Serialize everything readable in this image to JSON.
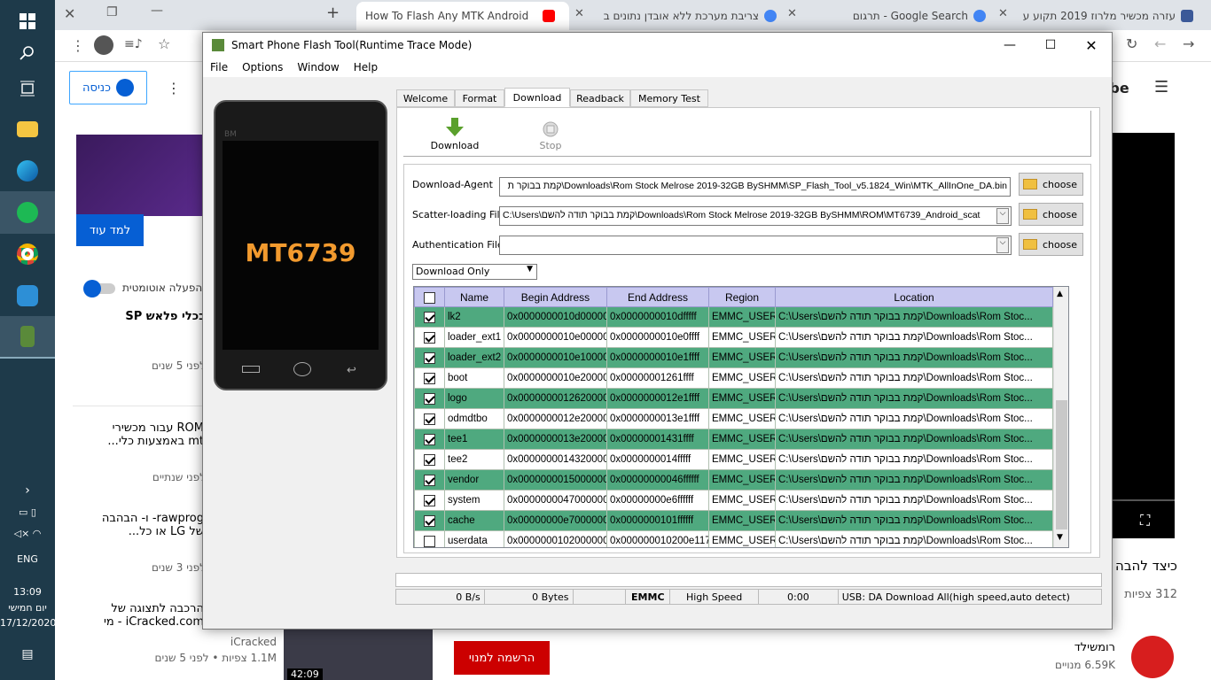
{
  "taskbar": {
    "lang": "ENG",
    "time": "13:09",
    "day": "יום חמישי",
    "date": "17/12/2020"
  },
  "browser": {
    "tabs": [
      {
        "title": "How To Flash Any MTK Android",
        "fav": "#ff0000"
      },
      {
        "title": "צריבת מערכת ללא אובדן נתונים ב",
        "fav": "#4285f4"
      },
      {
        "title": "Google Search - תרגום",
        "fav": "#4285f4"
      },
      {
        "title": "עזרה מכשיר מלרוז 2019 תקוע על",
        "fav": "#3b5998"
      }
    ],
    "new_tab": "+"
  },
  "yt": {
    "signin": "כניסה",
    "learn_more": "למד עוד",
    "autoplay": "הפעלה אוטומטית",
    "items": [
      {
        "title": "בכלי פלאש SP",
        "meta": "לפני 5 שנים"
      },
      {
        "title": "ROM עבור מכשירי mt באמצעות כלי...",
        "meta": "לפני שנתיים"
      },
      {
        "title": "rawprog- ו- הבהבה של LG או כל...",
        "meta": "לפני 3 שנים"
      },
      {
        "title": "הרכבה לתצוגה של iCracked.com - מי",
        "channel": "iCracked",
        "meta": "1.1M צפיות • לפני 5 שנים",
        "duration": "42:09"
      }
    ],
    "logo": "ube",
    "video_title": "כיצד להבה",
    "views": "312 צפיות",
    "channel": "רומשילד",
    "subs": "6.59K מנויים",
    "subscribe": "הרשמה למנוי"
  },
  "fw": {
    "title": "Smart Phone Flash Tool(Runtime Trace Mode)",
    "menu": [
      "File",
      "Options",
      "Window",
      "Help"
    ],
    "phone_model": "MT6739",
    "phone_brand": "BM",
    "tabs": [
      "Welcome",
      "Format",
      "Download",
      "Readback",
      "Memory Test"
    ],
    "download_btn": "Download",
    "stop_btn": "Stop",
    "da_label": "Download-Agent",
    "da_value": "קמת בבוקר ת\\Downloads\\Rom Stock Melrose 2019-32GB BySHMM\\SP_Flash_Tool_v5.1824_Win\\MTK_AllInOne_DA.bin",
    "scatter_label": "Scatter-loading File",
    "scatter_value": "C:\\Users\\קמת בבוקר תודה להשם\\Downloads\\Rom Stock Melrose 2019-32GB BySHMM\\ROM\\MT6739_Android_scat",
    "auth_label": "Authentication File",
    "auth_value": "",
    "choose": "choose",
    "mode": "Download Only",
    "cols": [
      "Name",
      "Begin Address",
      "End Address",
      "Region",
      "Location"
    ],
    "rows": [
      {
        "checked": true,
        "name": "lk2",
        "begin": "0x0000000010d00000",
        "end": "0x0000000010dfffff",
        "region": "EMMC_USER",
        "loc": "C:\\Users\\קמת בבוקר תודה להשם\\Downloads\\Rom Stoc..."
      },
      {
        "checked": true,
        "name": "loader_ext1",
        "begin": "0x0000000010e00000",
        "end": "0x0000000010e0ffff",
        "region": "EMMC_USER",
        "loc": "C:\\Users\\קמת בבוקר תודה להשם\\Downloads\\Rom Stoc..."
      },
      {
        "checked": true,
        "name": "loader_ext2",
        "begin": "0x0000000010e10000",
        "end": "0x0000000010e1ffff",
        "region": "EMMC_USER",
        "loc": "C:\\Users\\קמת בבוקר תודה להשם\\Downloads\\Rom Stoc..."
      },
      {
        "checked": true,
        "name": "boot",
        "begin": "0x0000000010e20000",
        "end": "0x00000001261ffff",
        "region": "EMMC_USER",
        "loc": "C:\\Users\\קמת בבוקר תודה להשם\\Downloads\\Rom Stoc..."
      },
      {
        "checked": true,
        "name": "logo",
        "begin": "0x0000000012620000",
        "end": "0x0000000012e1ffff",
        "region": "EMMC_USER",
        "loc": "C:\\Users\\קמת בבוקר תודה להשם\\Downloads\\Rom Stoc..."
      },
      {
        "checked": true,
        "name": "odmdtbo",
        "begin": "0x0000000012e20000",
        "end": "0x0000000013e1ffff",
        "region": "EMMC_USER",
        "loc": "C:\\Users\\קמת בבוקר תודה להשם\\Downloads\\Rom Stoc..."
      },
      {
        "checked": true,
        "name": "tee1",
        "begin": "0x0000000013e20000",
        "end": "0x00000001431ffff",
        "region": "EMMC_USER",
        "loc": "C:\\Users\\קמת בבוקר תודה להשם\\Downloads\\Rom Stoc..."
      },
      {
        "checked": true,
        "name": "tee2",
        "begin": "0x0000000014320000",
        "end": "0x0000000014fffff",
        "region": "EMMC_USER",
        "loc": "C:\\Users\\קמת בבוקר תודה להשם\\Downloads\\Rom Stoc..."
      },
      {
        "checked": true,
        "name": "vendor",
        "begin": "0x0000000015000000",
        "end": "0x00000000046ffffff",
        "region": "EMMC_USER",
        "loc": "C:\\Users\\קמת בבוקר תודה להשם\\Downloads\\Rom Stoc..."
      },
      {
        "checked": true,
        "name": "system",
        "begin": "0x0000000047000000",
        "end": "0x00000000e6ffffff",
        "region": "EMMC_USER",
        "loc": "C:\\Users\\קמת בבוקר תודה להשם\\Downloads\\Rom Stoc..."
      },
      {
        "checked": true,
        "name": "cache",
        "begin": "0x00000000e7000000",
        "end": "0x0000000101ffffff",
        "region": "EMMC_USER",
        "loc": "C:\\Users\\קמת בבוקר תודה להשם\\Downloads\\Rom Stoc..."
      },
      {
        "checked": false,
        "name": "userdata",
        "begin": "0x0000000102000000",
        "end": "0x000000010200e117",
        "region": "EMMC_USER",
        "loc": "C:\\Users\\קמת בבוקר תודה להשם\\Downloads\\Rom Stoc..."
      }
    ],
    "status": {
      "speed": "0 B/s",
      "bytes": "0 Bytes",
      "storage": "EMMC",
      "mode": "High Speed",
      "time": "0:00",
      "usb": "USB: DA Download All(high speed,auto detect)"
    }
  }
}
